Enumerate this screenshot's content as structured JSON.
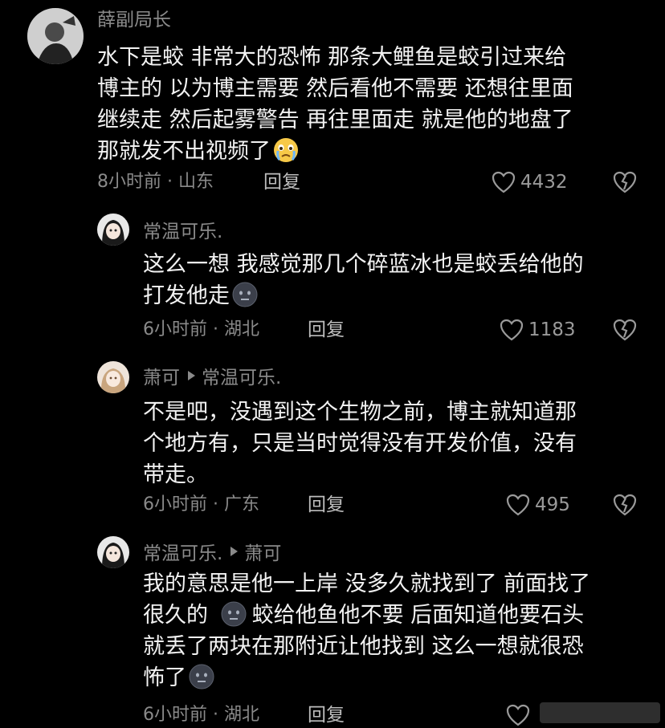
{
  "comments": [
    {
      "username": "薛副局长",
      "lines": [
        "水下是蛟 非常大的恐怖 那条大鲤鱼是蛟引过来给",
        "博主的 以为博主需要 然后看他不需要 还想往里面",
        "继续走  然后起雾警告  再往里面走 就是他的地盘了",
        "那就发不出视频了"
      ],
      "emoji": "crying-face-emoji",
      "time_location": "8小时前 · 山东",
      "reply_label": "回复",
      "likes": "4432"
    },
    {
      "username": "常温可乐.",
      "lines": [
        "这么一想 我感觉那几个碎蓝冰也是蛟丢给他的",
        "打发他走"
      ],
      "emoji": "dark-face-emoji",
      "time_location": "6小时前 · 湖北",
      "reply_label": "回复",
      "likes": "1183"
    },
    {
      "username": "萧可",
      "reply_to": "常温可乐.",
      "lines": [
        "不是吧，没遇到这个生物之前，博主就知道那",
        "个地方有，只是当时觉得没有开发价值，没有",
        "带走。"
      ],
      "time_location": "6小时前 · 广东",
      "reply_label": "回复",
      "likes": "495"
    },
    {
      "username": "常温可乐.",
      "reply_to": "萧可",
      "lines": [
        "我的意思是他一上岸 没多久就找到了 前面找了",
        "很久的",
        "蛟给他鱼他不要 后面知道他要石头",
        "就丢了两块在那附近让他找到 这么一想就很恐",
        "怖了"
      ],
      "emoji": "dark-face-emoji",
      "time_location": "6小时前 · 湖北",
      "reply_label": "回复"
    }
  ],
  "colors": {
    "background": "#000000",
    "text": "#f2f2f2",
    "secondary": "#8a8a8a"
  }
}
